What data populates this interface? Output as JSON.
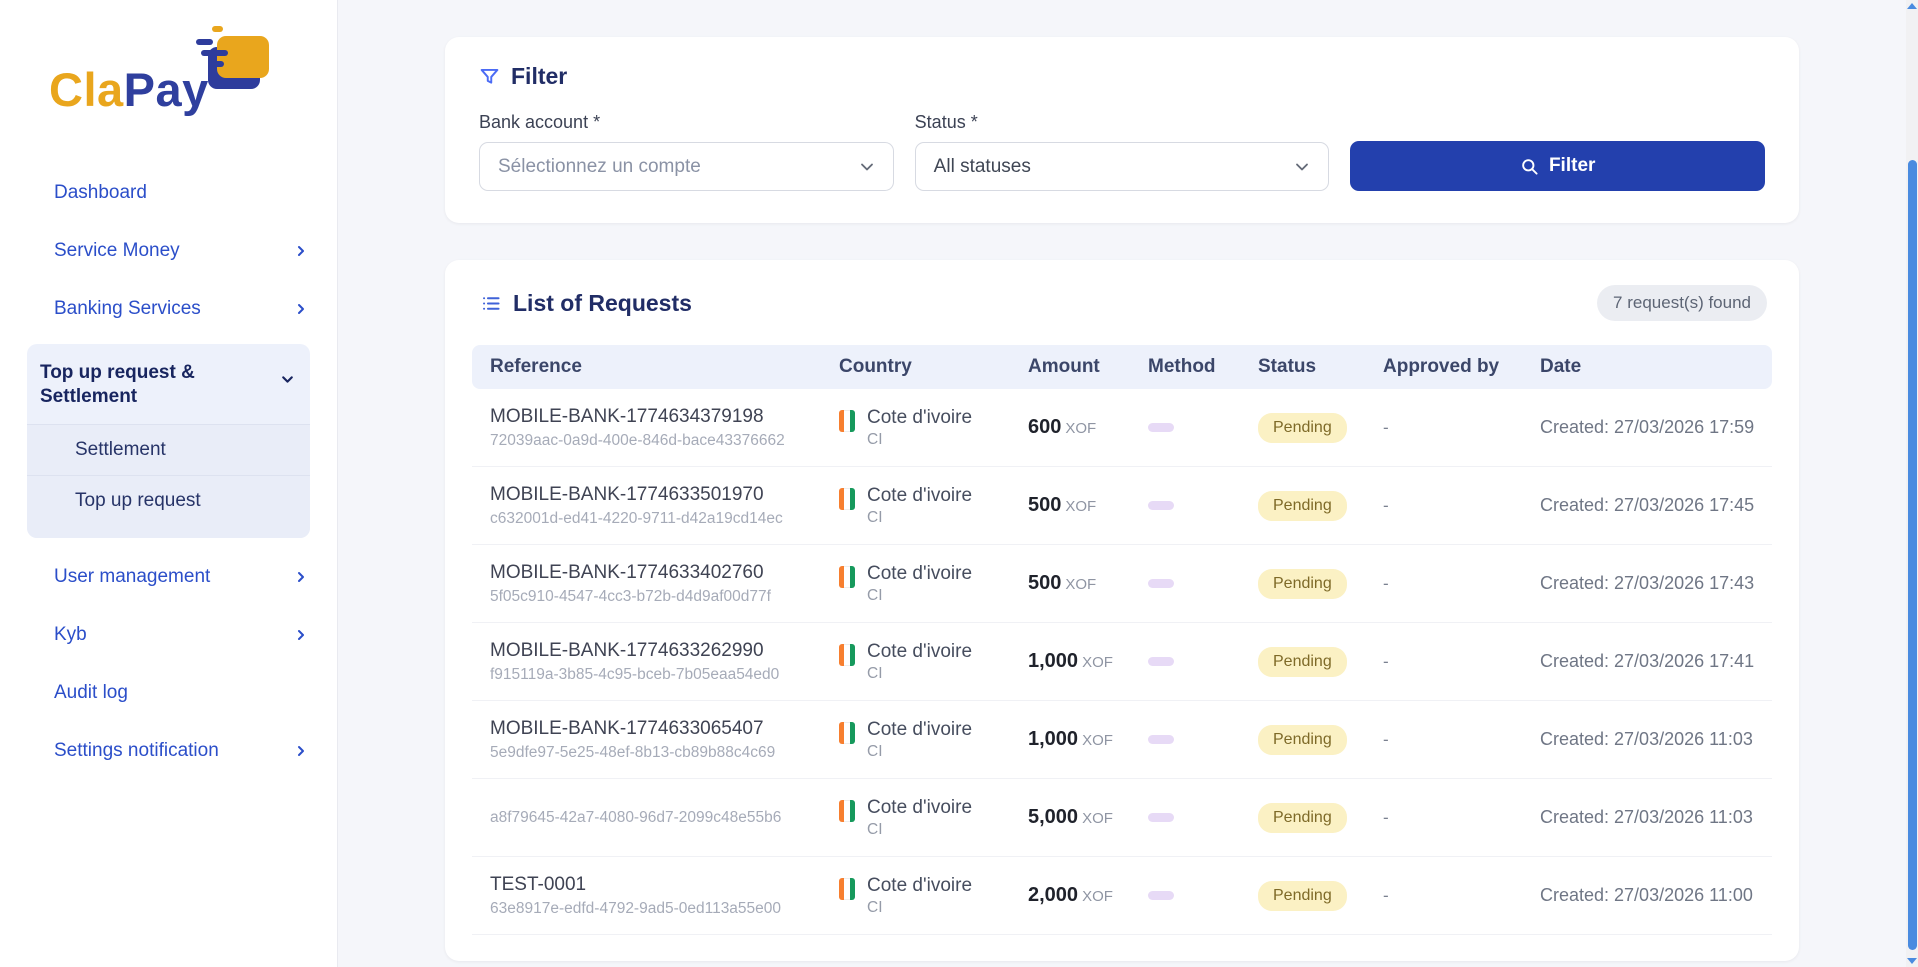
{
  "brand": {
    "name_part1": "Cla",
    "name_part2": "Pay"
  },
  "colors": {
    "brand_gold": "#e9a61d",
    "brand_blue": "#2f3f9e",
    "nav_link": "#2b4ec9",
    "primary_button": "#2340ad",
    "pending_badge_bg": "#fbf1c4",
    "pending_badge_text": "#7e6a28",
    "table_header_bg": "#edf1fb",
    "scrollbar_thumb": "#4a8be0"
  },
  "sidebar": {
    "items": [
      {
        "label": "Dashboard",
        "has_chevron": false
      },
      {
        "label": "Service Money",
        "has_chevron": true
      },
      {
        "label": "Banking Services",
        "has_chevron": true
      }
    ],
    "group": {
      "label": "Top up request & Settlement",
      "children": [
        {
          "label": "Settlement"
        },
        {
          "label": "Top up request"
        }
      ]
    },
    "items_lower": [
      {
        "label": "User management",
        "has_chevron": true
      },
      {
        "label": "Kyb",
        "has_chevron": true
      },
      {
        "label": "Audit log",
        "has_chevron": false
      },
      {
        "label": "Settings notification",
        "has_chevron": true
      }
    ]
  },
  "filter_card": {
    "title": "Filter",
    "bank_account_label": "Bank account *",
    "bank_account_placeholder": "Sélectionnez un compte",
    "status_label": "Status *",
    "status_value": "All statuses",
    "button_label": "Filter"
  },
  "list_card": {
    "title": "List of Requests",
    "count_badge": "7 request(s) found",
    "columns": [
      "Reference",
      "Country",
      "Amount",
      "Method",
      "Status",
      "Approved by",
      "Date"
    ],
    "rows": [
      {
        "reference": "MOBILE-BANK-1774634379198",
        "uuid": "72039aac-0a9d-400e-846d-bace43376662",
        "country": "Cote d'ivoire",
        "country_code": "CI",
        "amount": "600",
        "currency": "XOF",
        "status": "Pending",
        "approved_by": "-",
        "date": "Created: 27/03/2026 17:59"
      },
      {
        "reference": "MOBILE-BANK-1774633501970",
        "uuid": "c632001d-ed41-4220-9711-d42a19cd14ec",
        "country": "Cote d'ivoire",
        "country_code": "CI",
        "amount": "500",
        "currency": "XOF",
        "status": "Pending",
        "approved_by": "-",
        "date": "Created: 27/03/2026 17:45"
      },
      {
        "reference": "MOBILE-BANK-1774633402760",
        "uuid": "5f05c910-4547-4cc3-b72b-d4d9af00d77f",
        "country": "Cote d'ivoire",
        "country_code": "CI",
        "amount": "500",
        "currency": "XOF",
        "status": "Pending",
        "approved_by": "-",
        "date": "Created: 27/03/2026 17:43"
      },
      {
        "reference": "MOBILE-BANK-1774633262990",
        "uuid": "f915119a-3b85-4c95-bceb-7b05eaa54ed0",
        "country": "Cote d'ivoire",
        "country_code": "CI",
        "amount": "1,000",
        "currency": "XOF",
        "status": "Pending",
        "approved_by": "-",
        "date": "Created: 27/03/2026 17:41"
      },
      {
        "reference": "MOBILE-BANK-1774633065407",
        "uuid": "5e9dfe97-5e25-48ef-8b13-cb89b88c4c69",
        "country": "Cote d'ivoire",
        "country_code": "CI",
        "amount": "1,000",
        "currency": "XOF",
        "status": "Pending",
        "approved_by": "-",
        "date": "Created: 27/03/2026 11:03"
      },
      {
        "reference": "",
        "uuid": "a8f79645-42a7-4080-96d7-2099c48e55b6",
        "country": "Cote d'ivoire",
        "country_code": "CI",
        "amount": "5,000",
        "currency": "XOF",
        "status": "Pending",
        "approved_by": "-",
        "date": "Created: 27/03/2026 11:03"
      },
      {
        "reference": "TEST-0001",
        "uuid": "63e8917e-edfd-4792-9ad5-0ed113a55e00",
        "country": "Cote d'ivoire",
        "country_code": "CI",
        "amount": "2,000",
        "currency": "XOF",
        "status": "Pending",
        "approved_by": "-",
        "date": "Created: 27/03/2026 11:00"
      }
    ]
  }
}
